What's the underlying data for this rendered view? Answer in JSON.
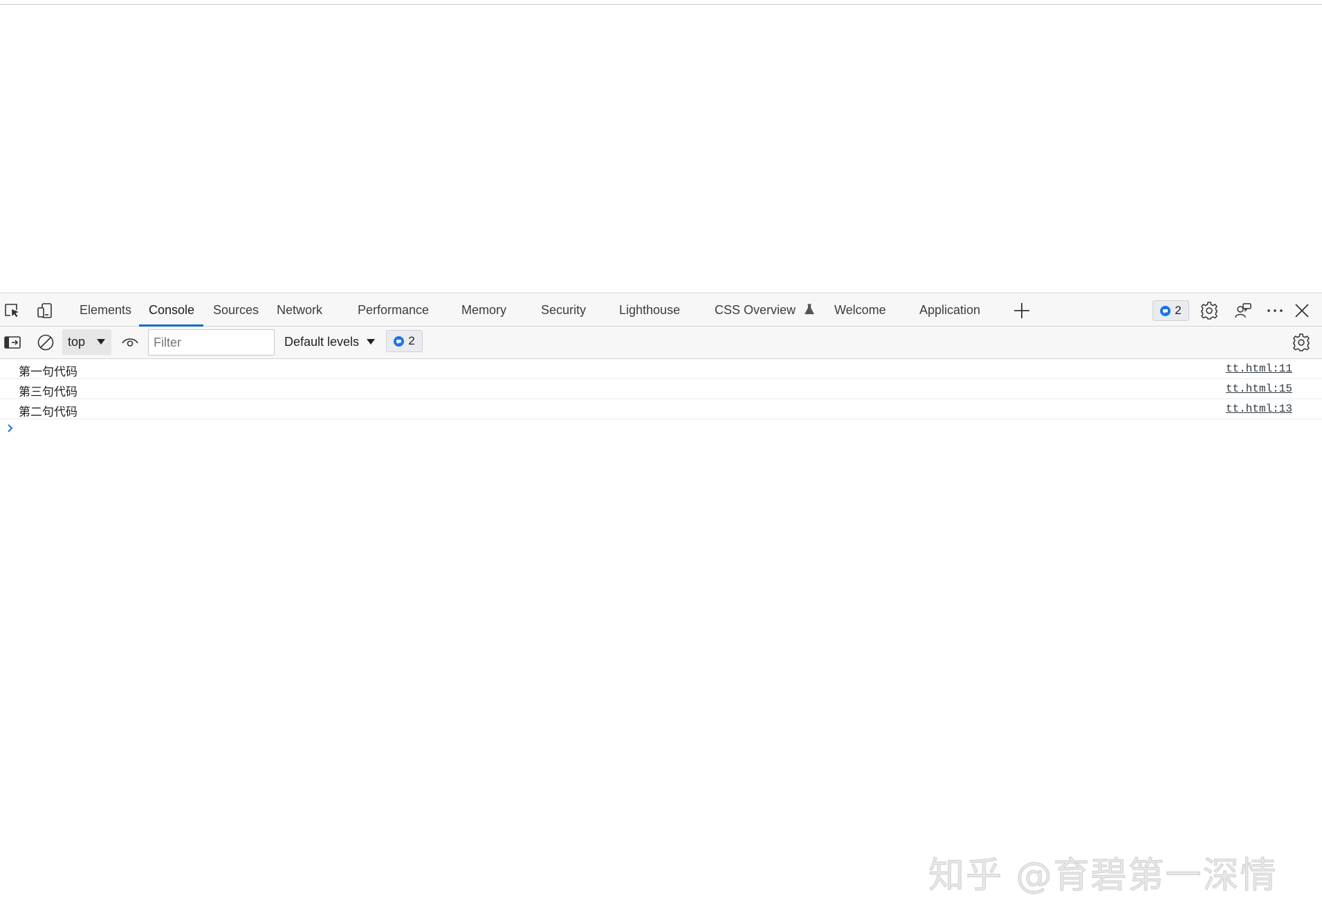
{
  "devtools": {
    "tabs": [
      {
        "label": "Elements"
      },
      {
        "label": "Console"
      },
      {
        "label": "Sources"
      },
      {
        "label": "Network"
      },
      {
        "label": "Performance"
      },
      {
        "label": "Memory"
      },
      {
        "label": "Security"
      },
      {
        "label": "Lighthouse"
      },
      {
        "label": "CSS Overview"
      },
      {
        "label": "Welcome"
      },
      {
        "label": "Application"
      }
    ],
    "active_tab": "Console",
    "issues_count": "2",
    "accent_color": "#0f6cbd"
  },
  "console_toolbar": {
    "context": "top",
    "filter_placeholder": "Filter",
    "filter_value": "",
    "levels_label": "Default levels",
    "issues_count": "2"
  },
  "messages": [
    {
      "text": "第一句代码",
      "source": "tt.html:11"
    },
    {
      "text": "第三句代码",
      "source": "tt.html:15"
    },
    {
      "text": "第二句代码",
      "source": "tt.html:13"
    }
  ],
  "watermark": "知乎 @育碧第一深情"
}
